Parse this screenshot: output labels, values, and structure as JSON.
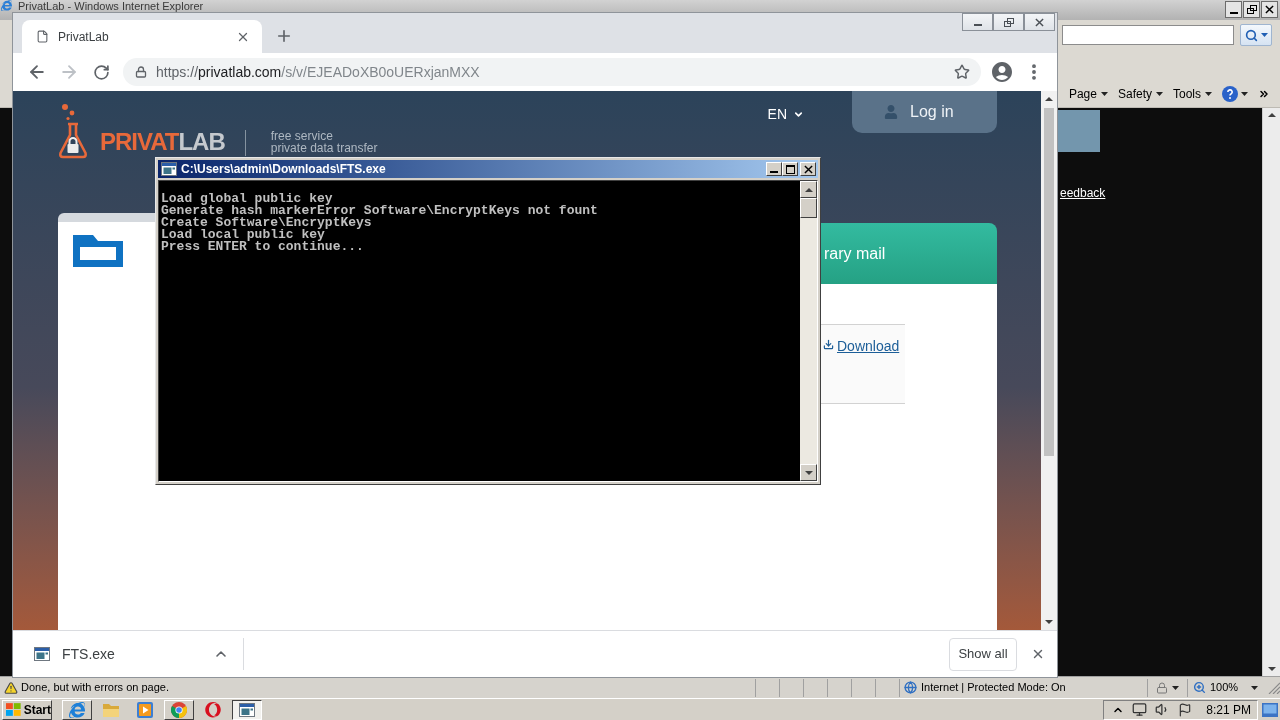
{
  "ie_window": {
    "title": "PrivatLab - Windows Internet Explorer",
    "command_bar": [
      {
        "label": "Page"
      },
      {
        "label": "Safety"
      },
      {
        "label": "Tools"
      }
    ],
    "content": {
      "link": "eedback"
    },
    "status_bar": {
      "message": "Done, but with errors on page.",
      "zone": "Internet | Protected Mode: On",
      "zoom": "100%"
    }
  },
  "chrome_window": {
    "tabs": [
      {
        "title": "PrivatLab",
        "selected": true
      }
    ],
    "nav_buttons": [
      {
        "kind": "back",
        "disabled": false
      },
      {
        "kind": "forward",
        "disabled": true
      },
      {
        "kind": "reload",
        "disabled": false
      }
    ],
    "url": {
      "scheme": "https://",
      "host": "privatlab.com",
      "path": "/s/v/EJEADoXB0oUERxjanMXX"
    },
    "downloads": {
      "items": [
        {
          "name": "FTS.exe"
        }
      ],
      "show_all": "Show all"
    }
  },
  "page": {
    "logo": {
      "part_1": "PRIVAT",
      "part_2": "LAB"
    },
    "tagline": [
      "free service",
      "private data transfer"
    ],
    "language": "EN",
    "login": "Log in",
    "mail_tab": "rary mail",
    "download_link": "Download"
  },
  "console_window": {
    "title": "C:\\Users\\admin\\Downloads\\FTS.exe",
    "lines": [
      "Load global public key",
      "Generate hash markerError Software\\EncryptKeys not fount",
      "Create Software\\EncryptKeys",
      "Load local public key",
      "Press ENTER to continue..."
    ]
  },
  "taskbar": {
    "start": "Start",
    "items": [
      {
        "kind": "ie",
        "open": true,
        "selected": false
      },
      {
        "kind": "explorer",
        "open": false,
        "selected": false
      },
      {
        "kind": "media_player",
        "open": false,
        "selected": false
      },
      {
        "kind": "chrome",
        "open": true,
        "selected": false
      },
      {
        "kind": "opera",
        "open": false,
        "selected": false
      },
      {
        "kind": "console",
        "open": true,
        "selected": true
      }
    ],
    "clock": "8:21 PM"
  }
}
